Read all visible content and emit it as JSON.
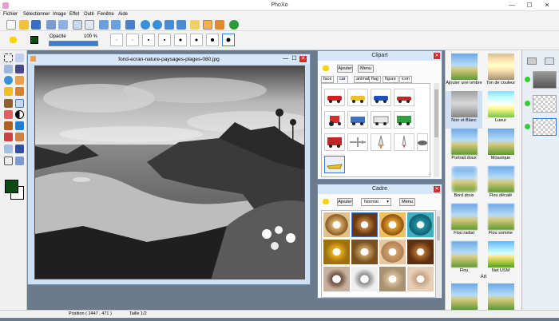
{
  "window": {
    "title": "PhoXo",
    "minimize": "—",
    "maximize": "☐",
    "close": "✕"
  },
  "menu": [
    "Fichier",
    "Sélectionner",
    "Image",
    "Effet",
    "Outil",
    "Fenêtre",
    "Aide"
  ],
  "options": {
    "opacity_label": "Opacité",
    "opacity_value": "100 %",
    "opacity_fraction": 1.0
  },
  "image_window": {
    "title": "fond-ecran-nature-paysages-plages-080.jpg"
  },
  "clipart": {
    "title": "Clipart",
    "add_button": "Ajouter",
    "menu_button": "Menu",
    "tabs": [
      "face",
      "car",
      "animal",
      "flag",
      "figure",
      "icon"
    ],
    "active_tab": "car"
  },
  "cadre": {
    "title": "Cadre",
    "add_button": "Ajouter",
    "blend_mode": "Normal",
    "menu_button": "Menu"
  },
  "effects": [
    "Ajouter une ombre",
    "Ton de couleur",
    "Noir et Blanc",
    "Lueur",
    "Portrait doux",
    "Mosaïque",
    "Bord doux",
    "Flou décalé",
    "Flou radial",
    "Flou somme",
    "Flou",
    "Net USM"
  ],
  "effects_section": "Art",
  "status": {
    "position": "Position ( 1447 , 471 )",
    "size": "Taille 1/2"
  },
  "colors": {
    "foreground": "#0a4d12",
    "background": "#ffffff",
    "accent": "#3a7bd5"
  }
}
